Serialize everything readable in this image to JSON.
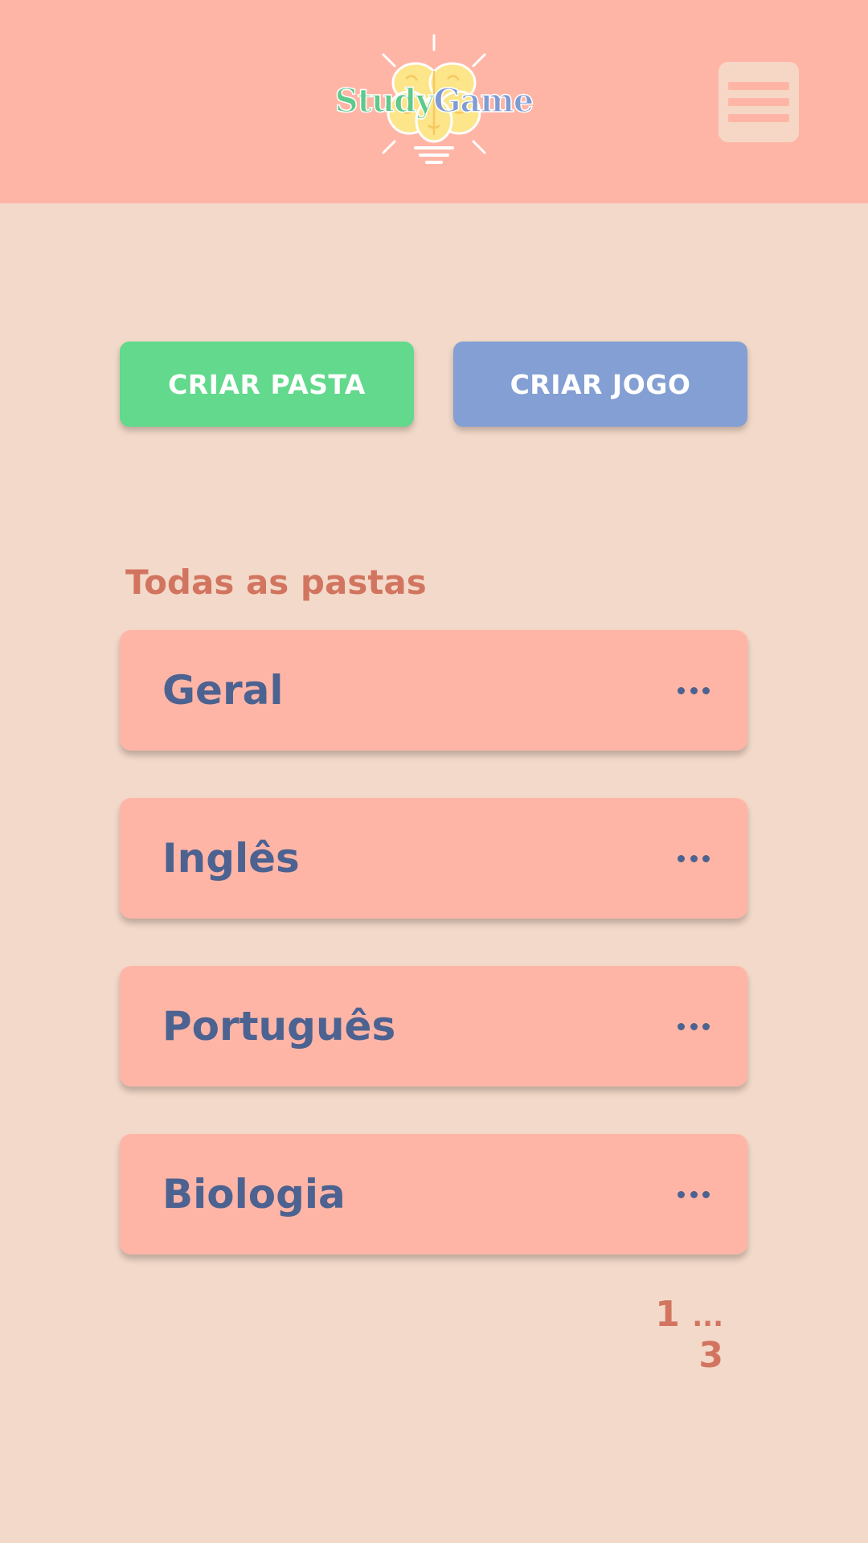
{
  "header": {
    "logo": {
      "part1": "Study",
      "part2": "Game"
    },
    "menu_icon": "hamburger-menu-icon"
  },
  "actions": {
    "create_folder_label": "CRIAR PASTA",
    "create_game_label": "CRIAR JOGO"
  },
  "folders_section": {
    "title": "Todas as pastas",
    "folders": [
      {
        "name": "Geral"
      },
      {
        "name": "Inglês"
      },
      {
        "name": "Português"
      },
      {
        "name": "Biologia"
      }
    ],
    "more_icon": "more-options-icon"
  },
  "pagination": {
    "current": "1",
    "ellipsis": "...",
    "last": "3"
  },
  "colors": {
    "background": "#f3d9c9",
    "header": "#ffb5a6",
    "green": "#62d98c",
    "blue": "#839fd3",
    "text_dark": "#4c6290",
    "accent": "#d27560"
  }
}
